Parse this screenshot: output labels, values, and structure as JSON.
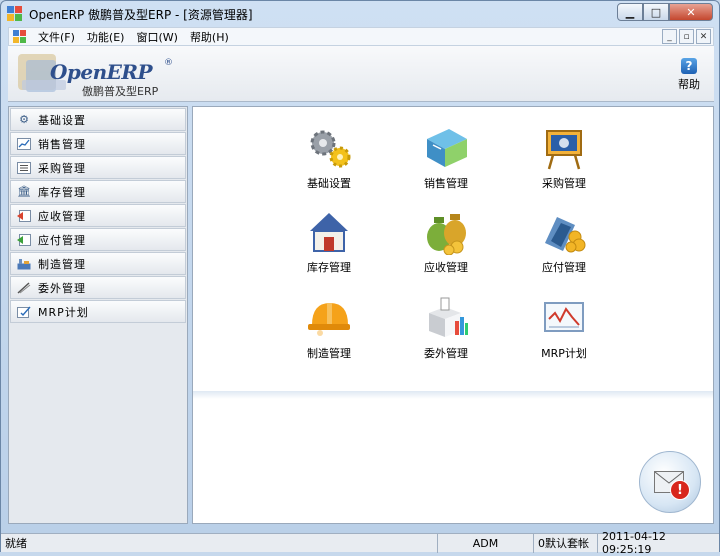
{
  "window": {
    "title": "OpenERP 傲鹏普及型ERP - [资源管理器]",
    "buttons": {
      "minimize": "▁",
      "maximize": "□",
      "close": "✕"
    }
  },
  "menubar": {
    "items": [
      "文件(F)",
      "功能(E)",
      "窗口(W)",
      "帮助(H)"
    ],
    "mdi_buttons": [
      "_",
      "▫",
      "✕"
    ]
  },
  "header": {
    "logo_text": "OpenERP",
    "logo_reg": "®",
    "logo_subtitle": "傲鹏普及型ERP",
    "help_label": "帮助",
    "help_icon": "?"
  },
  "sidebar": {
    "items": [
      {
        "label": "基础设置",
        "icon": "gear-icon"
      },
      {
        "label": "销售管理",
        "icon": "chart-line-icon"
      },
      {
        "label": "采购管理",
        "icon": "list-icon"
      },
      {
        "label": "库存管理",
        "icon": "warehouse-icon"
      },
      {
        "label": "应收管理",
        "icon": "receivable-icon"
      },
      {
        "label": "应付管理",
        "icon": "payable-icon"
      },
      {
        "label": "制造管理",
        "icon": "factory-icon"
      },
      {
        "label": "委外管理",
        "icon": "outsource-icon"
      },
      {
        "label": "MRP计划",
        "icon": "mrp-icon"
      }
    ]
  },
  "main": {
    "modules": [
      {
        "label": "基础设置",
        "icon": "gears-icon"
      },
      {
        "label": "销售管理",
        "icon": "sales-book-icon"
      },
      {
        "label": "采购管理",
        "icon": "purchase-board-icon"
      },
      {
        "label": "库存管理",
        "icon": "house-icon"
      },
      {
        "label": "应收管理",
        "icon": "money-bags-icon"
      },
      {
        "label": "应付管理",
        "icon": "payable-coins-icon"
      },
      {
        "label": "制造管理",
        "icon": "hard-hat-icon"
      },
      {
        "label": "委外管理",
        "icon": "outsource-box-icon"
      },
      {
        "label": "MRP计划",
        "icon": "mrp-chart-icon"
      }
    ]
  },
  "statusbar": {
    "status": "就绪",
    "user": "ADM",
    "account": "0默认套帐",
    "datetime": "2011-04-12 09:25:19"
  },
  "colors": {
    "title_gradient_top": "#cfe0f3",
    "accent_blue": "#2e4f8c",
    "close_red": "#c4472e"
  }
}
